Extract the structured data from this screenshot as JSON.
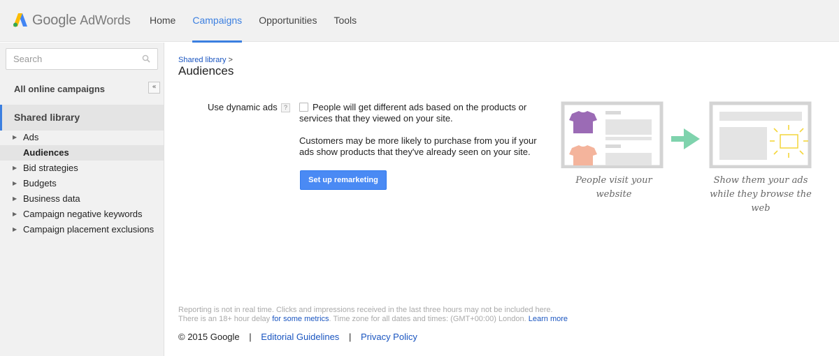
{
  "header": {
    "logo_google": "Google",
    "logo_product": "AdWords",
    "tabs": [
      {
        "label": "Home"
      },
      {
        "label": "Campaigns",
        "active": true
      },
      {
        "label": "Opportunities"
      },
      {
        "label": "Tools"
      }
    ]
  },
  "sidebar": {
    "search_placeholder": "Search",
    "all_campaigns": "All online campaigns",
    "collapse_glyph": "«",
    "shared_library": "Shared library",
    "items": [
      {
        "label": "Ads",
        "expandable": true
      },
      {
        "label": "Audiences",
        "selected": true
      },
      {
        "label": "Bid strategies",
        "expandable": true
      },
      {
        "label": "Budgets",
        "expandable": true
      },
      {
        "label": "Business data",
        "expandable": true
      },
      {
        "label": "Campaign negative keywords",
        "expandable": true
      },
      {
        "label": "Campaign placement exclusions",
        "expandable": true
      }
    ]
  },
  "main": {
    "breadcrumb": "Shared library",
    "breadcrumb_sep": ">",
    "title": "Audiences",
    "dynamic_label": "Use dynamic ads",
    "help_glyph": "?",
    "checkbox_text": "People will get different ads based on the products or services that they viewed on your site.",
    "description": "Customers may be more likely to purchase from you if your ads show products that they've already seen on your site.",
    "cta": "Set up remarketing",
    "illustration": {
      "caption_left_1": "People visit your",
      "caption_left_2": "website",
      "caption_right_1": "Show them your ads",
      "caption_right_2": "while they browse the",
      "caption_right_3": "web",
      "colors": {
        "shirt_purple": "#9b6bb5",
        "shirt_peach": "#f4b49c",
        "arrow": "#7fd3ad",
        "sun": "#f4d63b"
      }
    }
  },
  "footer": {
    "note_line1": "Reporting is not in real time. Clicks and impressions received in the last three hours may not be included here.",
    "note_line2_pre": "There is an 18+ hour delay ",
    "note_line2_link": "for some metrics",
    "note_line2_mid": ". Time zone for all dates and times: (GMT+00:00) London. ",
    "note_line2_link2": "Learn more",
    "copyright": "© 2015 Google",
    "sep": "|",
    "editorial": "Editorial Guidelines",
    "privacy": "Privacy Policy"
  }
}
